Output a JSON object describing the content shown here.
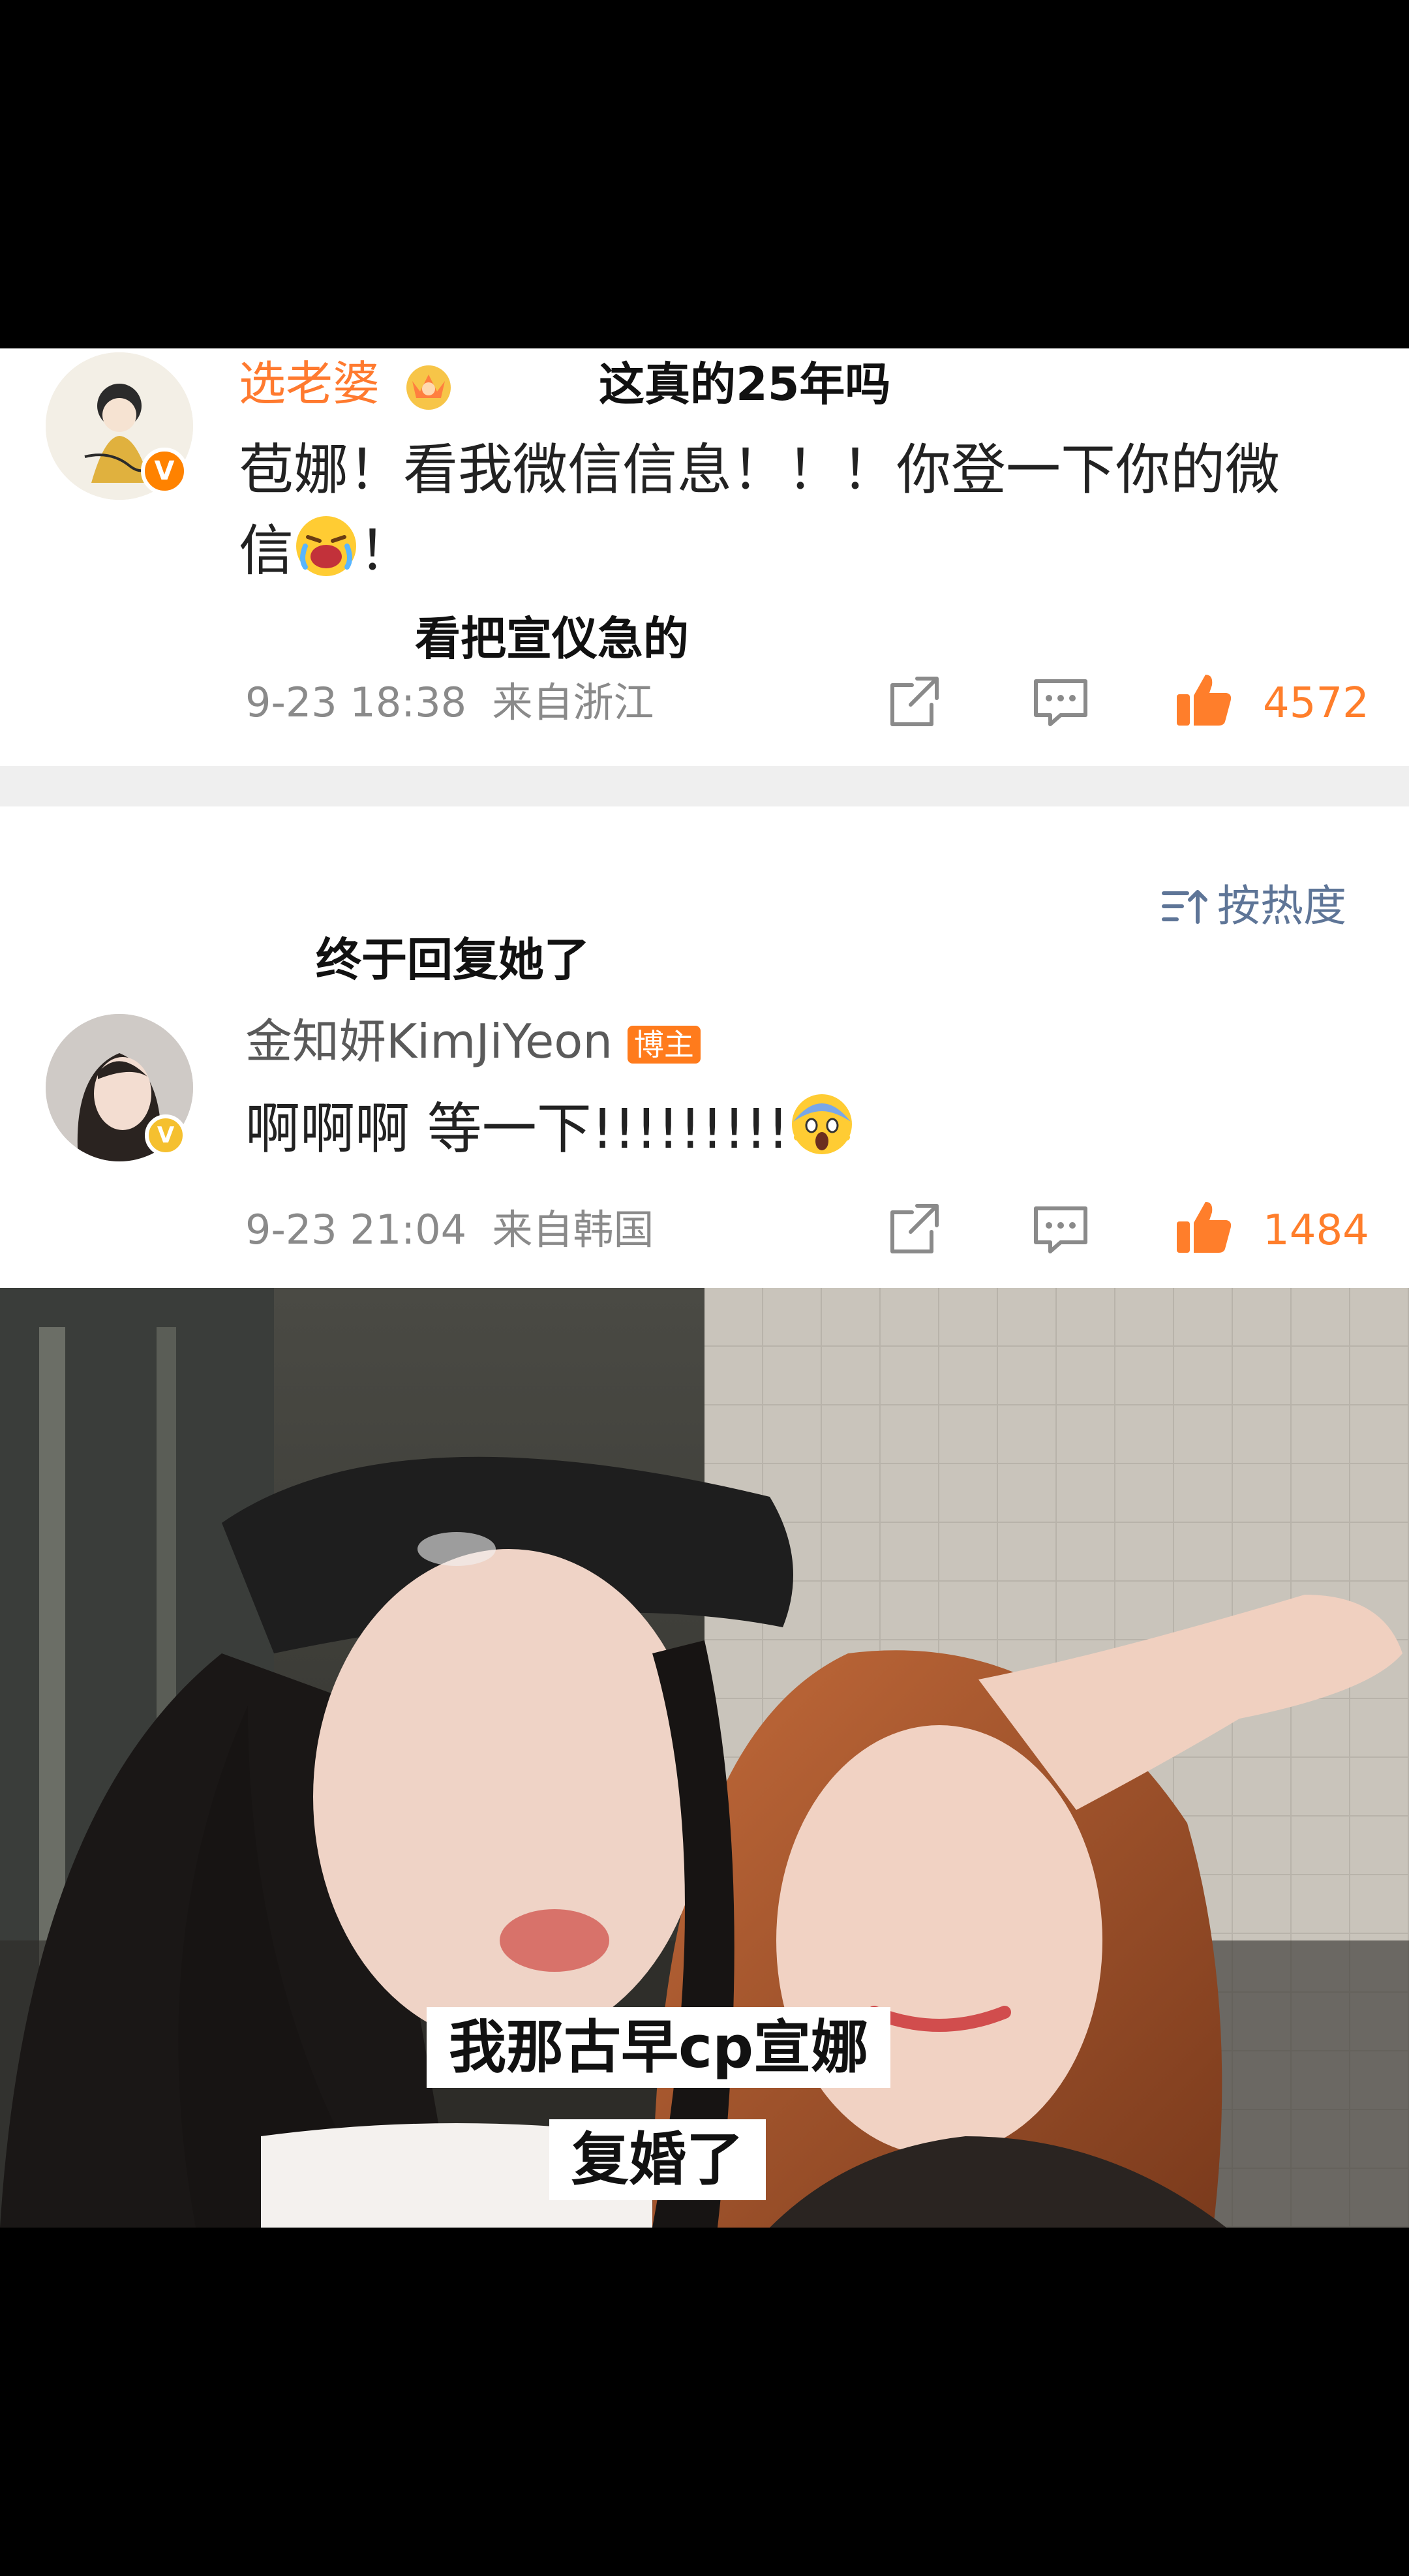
{
  "comment1": {
    "username": "选老婆",
    "text_line1": "苞娜！看我微信信息！！！你登一下你的微",
    "text_line2_prefix": "信",
    "text_line2_suffix": "！",
    "time": "9-23 18:38",
    "location": "来自浙江",
    "likes": "4572"
  },
  "comment2": {
    "sort_label": "按热度",
    "username": "金知妍KimJiYeon",
    "tag": "博主",
    "text": "啊啊啊 等一下!!!!!!!!!",
    "time": "9-23 21:04",
    "location": "来自韩国",
    "likes": "1484"
  },
  "captions": {
    "top": "这真的25年吗",
    "mid": "看把宣仪急的",
    "reply": "终于回复她了"
  },
  "photo_subtitles": [
    "我那古早cp宣娜",
    "复婚了"
  ],
  "colors": {
    "username_orange": "#ff7a2f",
    "username_gray": "#5a5a5a",
    "like_orange": "#ff7e2b",
    "badge_orange": "#ff7b1c",
    "badge_yellow": "#f5c02f"
  }
}
